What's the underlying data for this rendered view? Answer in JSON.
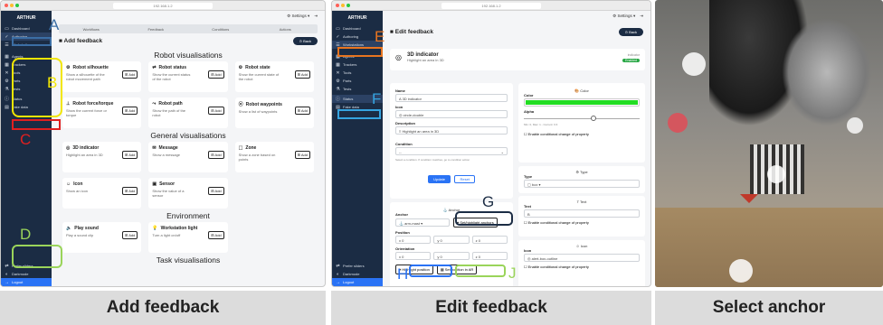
{
  "panels": {
    "add": {
      "caption": "Add feedback",
      "url": "192.168.1.2",
      "app_name": "ARTHUR",
      "sidebar": [
        "Dashboard",
        "Authoring",
        "Workstations",
        "Agents",
        "Trackers",
        "Tools",
        "Parts",
        "Tests",
        "Status",
        "Fake data"
      ],
      "sidebar_icons": [
        "monitor-icon",
        "check-icon",
        "list-icon",
        "grid-icon",
        "grid-icon",
        "cross-icon",
        "gear-icon",
        "flask-icon",
        "info-icon",
        "database-icon"
      ],
      "bottom": [
        "Prefer sliders",
        "Darkmode",
        "Logout"
      ],
      "header_settings": "Settings",
      "tabs": [
        "Workflows",
        "Feedback",
        "Conditions",
        "Actions"
      ],
      "title": "Add feedback",
      "back": "Back",
      "sections": [
        {
          "name": "Robot visualisations",
          "cards": [
            {
              "title": "Robot silhouette",
              "desc": "Show a silhouette of the robot movement path",
              "icon": "robot-icon"
            },
            {
              "title": "Robot status",
              "desc": "Show the current status of the robot",
              "icon": "arrows-icon"
            },
            {
              "title": "Robot state",
              "desc": "Show the current state of the robot",
              "icon": "robot-icon"
            },
            {
              "title": "Robot force/torque",
              "desc": "Show the current force or torque",
              "icon": "axes-icon"
            },
            {
              "title": "Robot path",
              "desc": "Show the path of the robot",
              "icon": "path-icon"
            },
            {
              "title": "Robot waypoints",
              "desc": "Show a list of waypoints",
              "icon": "pin-icon"
            }
          ]
        },
        {
          "name": "General visualisations",
          "cards": [
            {
              "title": "3D indicator",
              "desc": "Highlight an area in 3D",
              "icon": "target-icon"
            },
            {
              "title": "Message",
              "desc": "Show a message",
              "icon": "message-icon"
            },
            {
              "title": "Zone",
              "desc": "Show a zone based on points",
              "icon": "zone-icon"
            },
            {
              "title": "Icon",
              "desc": "Show an icon",
              "icon": "icon-icon"
            },
            {
              "title": "Sensor",
              "desc": "Show the value of a sensor",
              "icon": "sensor-icon"
            }
          ]
        },
        {
          "name": "Environment",
          "cards": [
            {
              "title": "Play sound",
              "desc": "Play a sound clip",
              "icon": "speaker-icon"
            },
            {
              "title": "Workstation light",
              "desc": "Turn a light on/off",
              "icon": "bulb-icon"
            }
          ]
        },
        {
          "name": "Task visualisations",
          "cards": []
        }
      ],
      "add_label": "Add"
    },
    "edit": {
      "caption": "Edit feedback",
      "title": "Edit feedback",
      "back": "Back",
      "item_title": "3D indicator",
      "item_desc": "Highlight an area in 3D",
      "item_id": "indicator",
      "item_status": "Enabled",
      "name_label": "Name",
      "name_value": "3D indicator",
      "icon_label": "Icon",
      "icon_value": "circle-double",
      "desc_label": "Description",
      "desc_value": "Highlight an area in 3D",
      "cond_label": "Condition",
      "cond_value": "--",
      "cond_hint": "Select a condition. If condition matches, go to condition action",
      "update": "Update",
      "reset": "Reset",
      "anchor_heading": "Anchor",
      "anchor_label": "Anchor",
      "anchor_value": "arm-mast",
      "set_anchor": "Set/highlight anchors",
      "position_label": "Position",
      "position": [
        "0",
        "0",
        "0"
      ],
      "orientation_label": "Orientation",
      "orientation": [
        "0",
        "0",
        "0"
      ],
      "highlight_position": "Highlight position",
      "set_position_ar": "Set position in AR",
      "color_heading": "Color",
      "color_label": "Color",
      "color_value": "#22dd22",
      "alpha_label": "Alpha",
      "alpha_hint": "Min: 0, Max: 1 - Current: 0.6",
      "alpha": 0.6,
      "cond_change": "Enable conditional change of property",
      "type_heading": "Type",
      "type_label": "Type",
      "type_value": "box",
      "text_heading": "Text",
      "text_label": "Text",
      "text_value": "B",
      "icon_heading": "Icon",
      "icon2_label": "Icon",
      "icon2_value": "alert-box-outline"
    },
    "anchor": {
      "caption": "Select anchor"
    }
  },
  "annotations": {
    "add": [
      {
        "letter": "A",
        "color": "#3b6ea5"
      },
      {
        "letter": "B",
        "color": "#f2e600"
      },
      {
        "letter": "C",
        "color": "#e02020"
      },
      {
        "letter": "D",
        "color": "#9ad45a"
      }
    ],
    "edit": [
      {
        "letter": "E",
        "color": "#e87520"
      },
      {
        "letter": "F",
        "color": "#35a4e0"
      },
      {
        "letter": "G",
        "color": "#1b2c44"
      },
      {
        "letter": "H",
        "color": "#2a73f5"
      },
      {
        "letter": "J",
        "color": "#9ad45a"
      }
    ]
  }
}
